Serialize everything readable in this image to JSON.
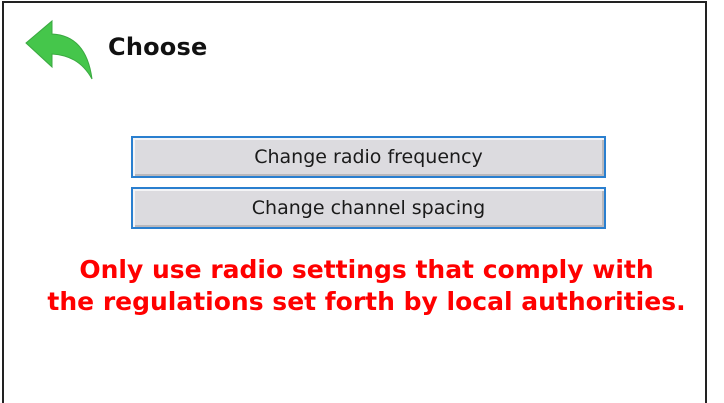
{
  "header": {
    "back_icon": "back-arrow-icon",
    "title": "Choose"
  },
  "actions": [
    {
      "label": "Change radio frequency"
    },
    {
      "label": "Change channel spacing"
    }
  ],
  "warning": {
    "line1": "Only use radio settings that comply with",
    "line2": "the regulations set forth by local authorities."
  },
  "colors": {
    "back_arrow": "#45c64b",
    "button_border": "#2a7fcf",
    "button_fill": "#dcdbdf",
    "warning_text": "#ff0000"
  }
}
